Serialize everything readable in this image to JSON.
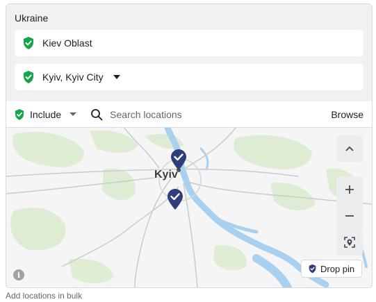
{
  "header": {
    "country": "Ukraine"
  },
  "selected_locations": [
    {
      "label": "Kiev Oblast",
      "icon": "green-shield-check-icon"
    },
    {
      "label": "Kyiv, Kyiv City",
      "icon": "green-shield-check-icon",
      "has_dropdown": true
    }
  ],
  "search_bar": {
    "mode_label": "Include",
    "search_placeholder": "Search locations",
    "browse_label": "Browse"
  },
  "map": {
    "city_label": "Kyiv",
    "controls": {
      "collapse": "^",
      "zoom_in": "+",
      "zoom_out": "−"
    },
    "drop_pin_label": "Drop pin",
    "pin_color": "#2d3e7a",
    "water_color": "#a9d1ef",
    "forest_color": "#dbeccf"
  },
  "footer": {
    "bulk_link": "Add locations in bulk"
  },
  "colors": {
    "accent_green": "#16a34a"
  }
}
